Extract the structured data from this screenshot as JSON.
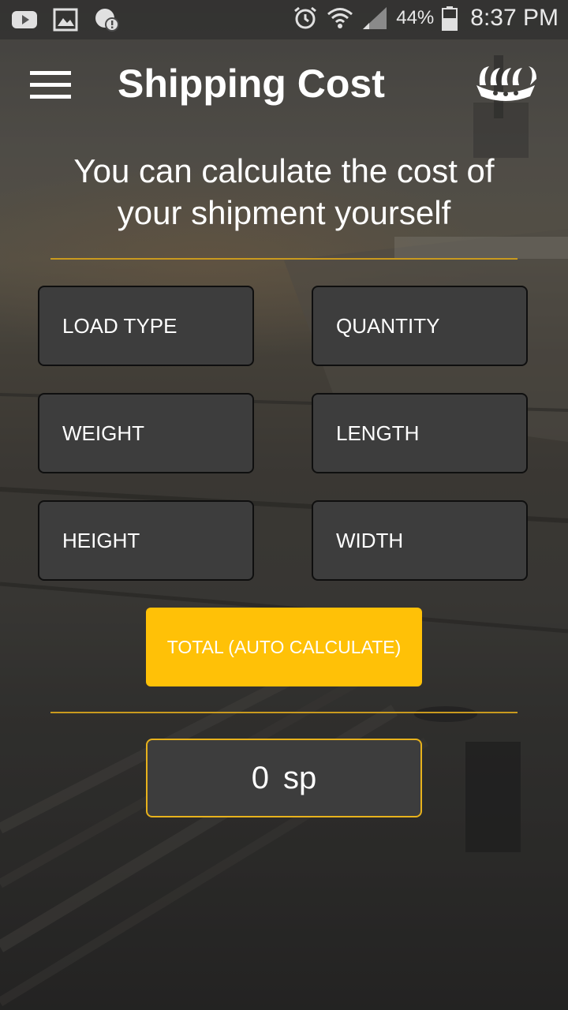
{
  "status_bar": {
    "icons": [
      "youtube-icon",
      "gallery-icon",
      "notification-alert-icon",
      "alarm-icon",
      "wifi-icon",
      "signal-icon",
      "battery-icon"
    ],
    "battery_percent": "44%",
    "time": "8:37 PM"
  },
  "app_bar": {
    "title": "Shipping Cost",
    "menu_icon": "hamburger-menu-icon",
    "logo_icon": "viking-ship-logo"
  },
  "headline": {
    "line1": "You can calculate the cost of",
    "line2": "your shipment yourself"
  },
  "form": {
    "load_type": {
      "placeholder": "LOAD TYPE",
      "value": ""
    },
    "quantity": {
      "placeholder": "QUANTITY",
      "value": ""
    },
    "weight": {
      "placeholder": "WEIGHT",
      "value": ""
    },
    "length": {
      "placeholder": "LENGTH",
      "value": ""
    },
    "height": {
      "placeholder": "HEIGHT",
      "value": ""
    },
    "width": {
      "placeholder": "WIDTH",
      "value": ""
    }
  },
  "calculate_button": {
    "label": "TOTAL (AUTO CALCULATE)"
  },
  "total": {
    "value": "0",
    "unit": "sp"
  },
  "colors": {
    "accent": "#ffc107",
    "divider": "#c99a1e",
    "field_bg": "#3d3d3d",
    "text": "#ffffff"
  }
}
